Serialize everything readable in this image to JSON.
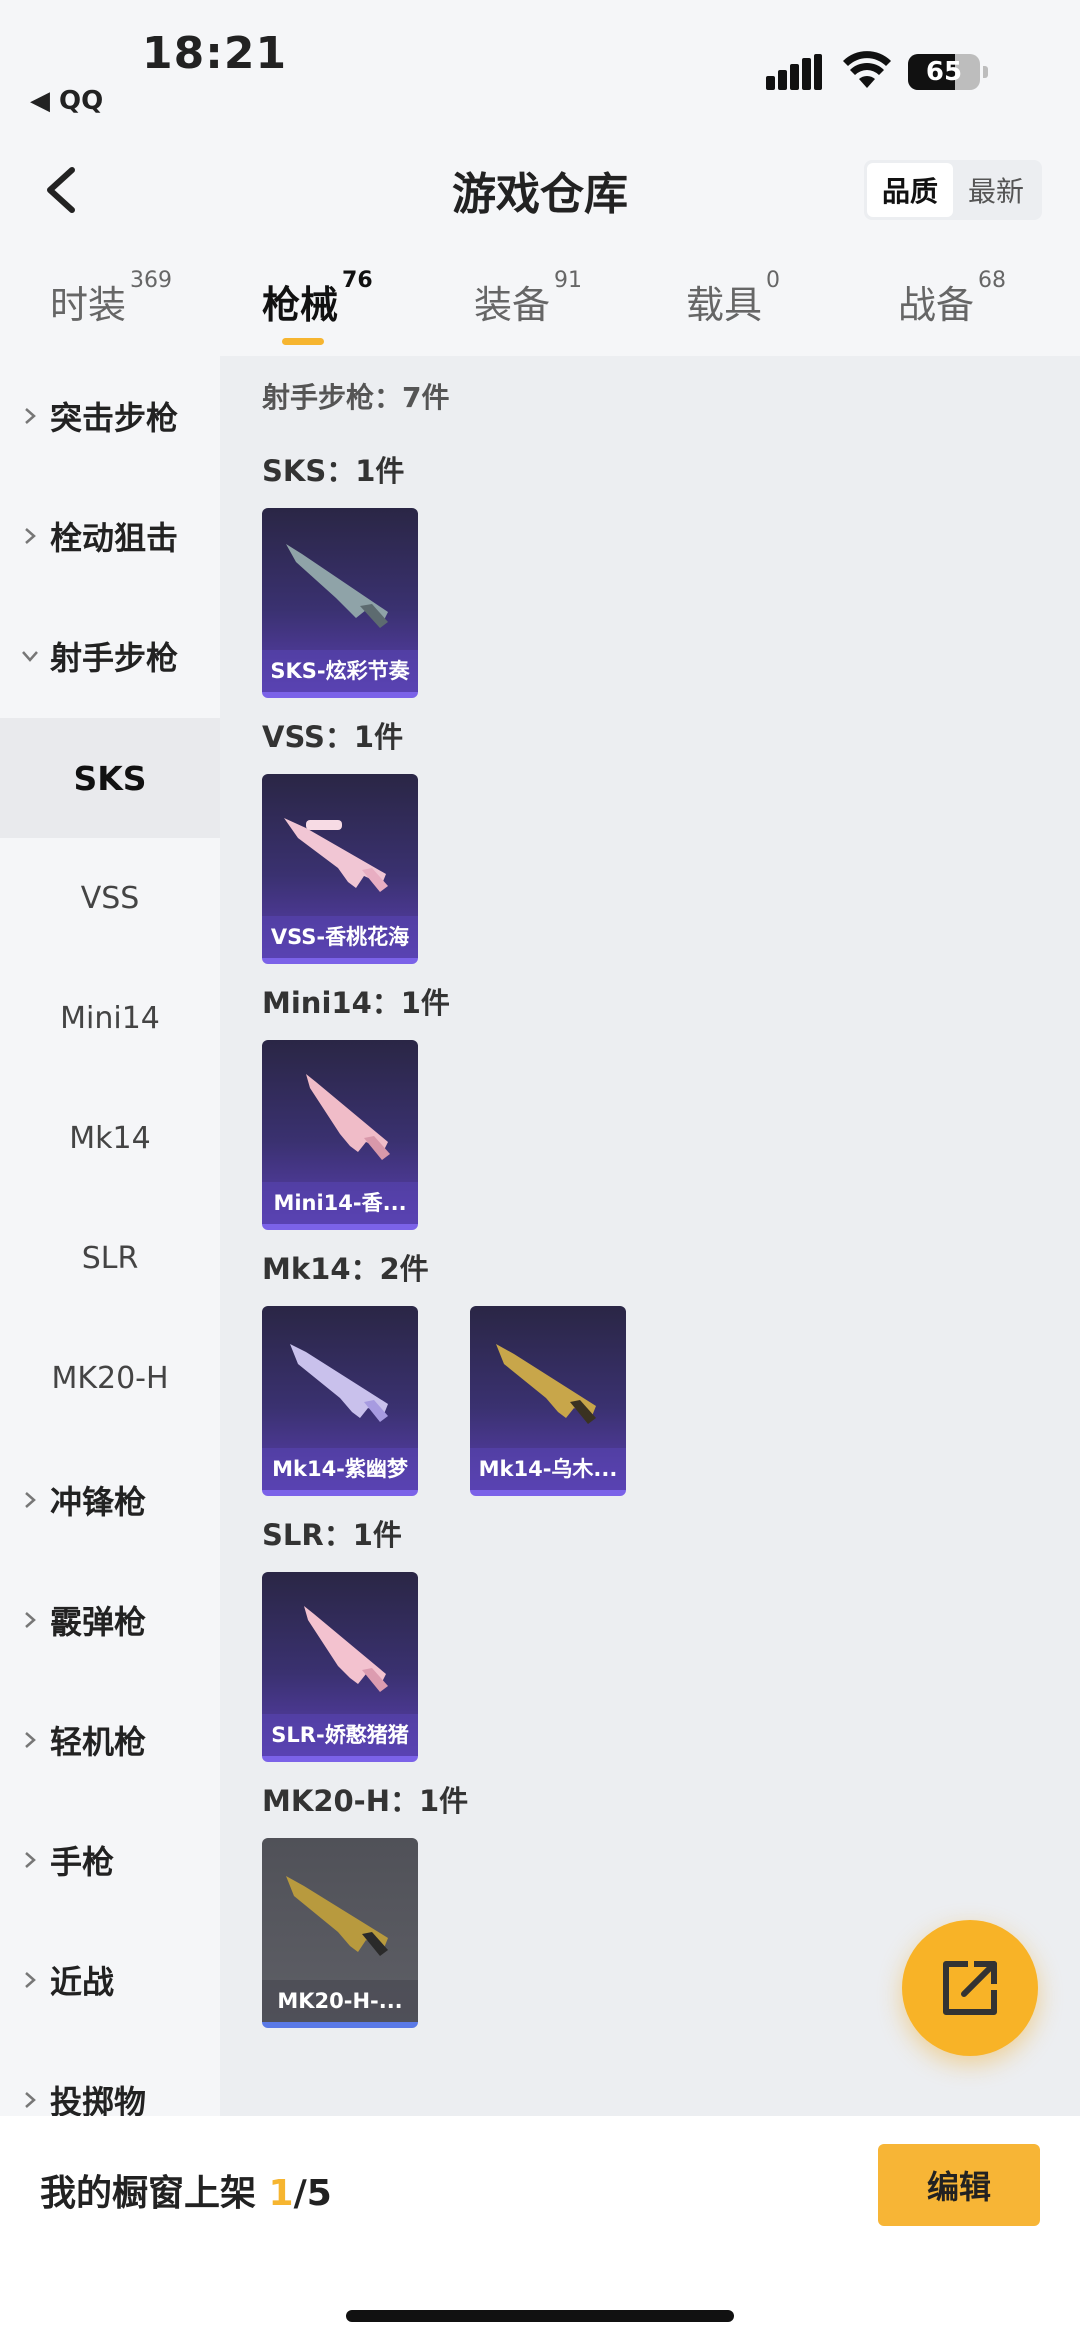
{
  "status_bar": {
    "time": "18:21",
    "back_app": "◀ QQ",
    "battery": "65"
  },
  "header": {
    "title": "游戏仓库",
    "sort_options": [
      "品质",
      "最新"
    ],
    "sort_active": "品质"
  },
  "tabs": [
    {
      "label": "时装",
      "count": "369"
    },
    {
      "label": "枪械",
      "count": "76"
    },
    {
      "label": "装备",
      "count": "91"
    },
    {
      "label": "载具",
      "count": "0"
    },
    {
      "label": "战备",
      "count": "68"
    }
  ],
  "sidebar": {
    "items": [
      {
        "label": "突击步枪",
        "type": "category",
        "expanded": false
      },
      {
        "label": "栓动狙击",
        "type": "category",
        "expanded": false
      },
      {
        "label": "射手步枪",
        "type": "category",
        "expanded": true
      },
      {
        "label": "SKS",
        "type": "sub",
        "active": true
      },
      {
        "label": "VSS",
        "type": "sub"
      },
      {
        "label": "Mini14",
        "type": "sub"
      },
      {
        "label": "Mk14",
        "type": "sub"
      },
      {
        "label": "SLR",
        "type": "sub"
      },
      {
        "label": "MK20-H",
        "type": "sub"
      },
      {
        "label": "冲锋枪",
        "type": "category",
        "expanded": false
      },
      {
        "label": "霰弹枪",
        "type": "category",
        "expanded": false
      },
      {
        "label": "轻机枪",
        "type": "category",
        "expanded": false
      },
      {
        "label": "手枪",
        "type": "category",
        "expanded": false
      },
      {
        "label": "近战",
        "type": "category",
        "expanded": false
      },
      {
        "label": "投掷物",
        "type": "category",
        "expanded": false
      }
    ]
  },
  "content": {
    "summary": "射手步枪：7件",
    "groups": [
      {
        "title": "SKS：1件",
        "items": [
          {
            "name": "SKS-炫彩节奏",
            "rarity": "purple"
          }
        ]
      },
      {
        "title": "VSS：1件",
        "items": [
          {
            "name": "VSS-香桃花海",
            "rarity": "purple"
          }
        ]
      },
      {
        "title": "Mini14：1件",
        "items": [
          {
            "name": "Mini14-香...",
            "rarity": "purple"
          }
        ]
      },
      {
        "title": "Mk14：2件",
        "items": [
          {
            "name": "Mk14-紫幽梦",
            "rarity": "purple"
          },
          {
            "name": "Mk14-乌木...",
            "rarity": "purple"
          }
        ]
      },
      {
        "title": "SLR：1件",
        "items": [
          {
            "name": "SLR-娇憨猪猪",
            "rarity": "purple"
          }
        ]
      },
      {
        "title": "MK20-H：1件",
        "items": [
          {
            "name": "MK20-H-...",
            "rarity": "blue"
          }
        ]
      }
    ]
  },
  "bottom_bar": {
    "showcase_label": "我的橱窗上架 ",
    "showcase_current": "1",
    "showcase_total": "/5",
    "edit_label": "编辑"
  },
  "colors": {
    "accent": "#f6b530",
    "card_purple": "#3a3170",
    "card_gray": "#5e5f66"
  }
}
